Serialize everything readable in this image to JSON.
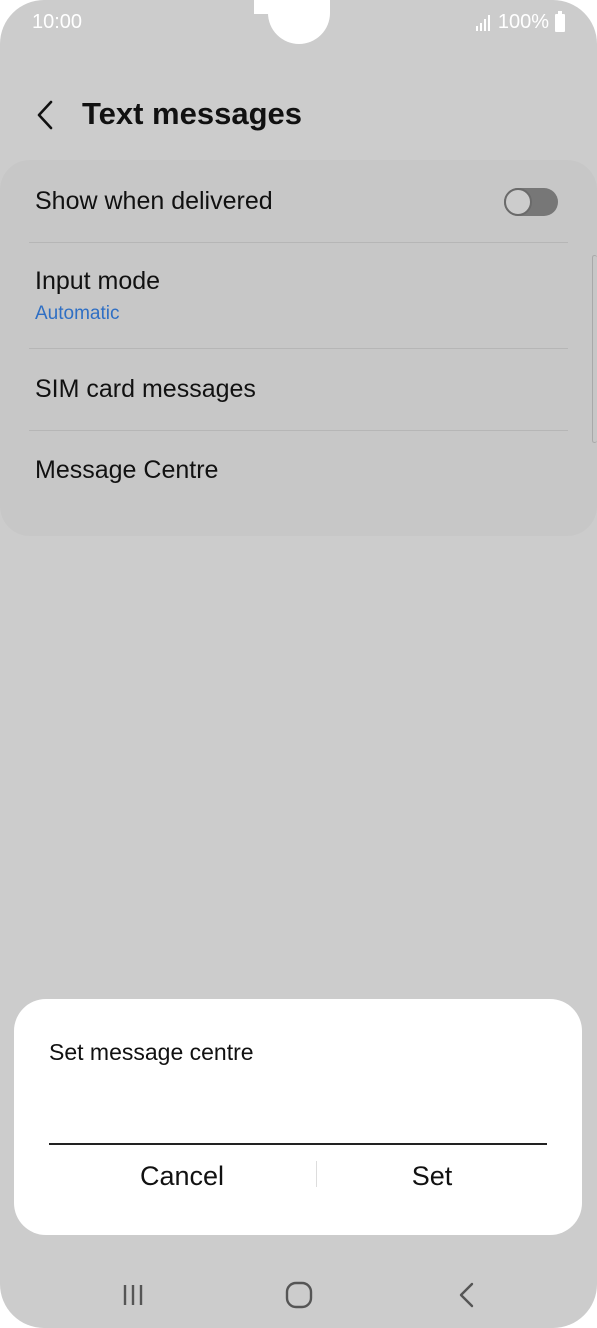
{
  "status_bar": {
    "time": "10:00",
    "battery": "100%",
    "icons": [
      "signal-icon",
      "battery-icon"
    ]
  },
  "header": {
    "title": "Text messages",
    "back_icon": "chevron-left-icon"
  },
  "settings": {
    "show_when_delivered": {
      "label": "Show when delivered",
      "enabled": false
    },
    "input_mode": {
      "label": "Input mode",
      "value": "Automatic"
    },
    "sim_card_messages": {
      "label": "SIM card messages"
    },
    "message_centre": {
      "label": "Message Centre"
    }
  },
  "dialog": {
    "title": "Set message centre",
    "input_value": "",
    "cancel_label": "Cancel",
    "set_label": "Set"
  },
  "nav_bar": {
    "icons": [
      "recents-icon",
      "home-icon",
      "back-icon"
    ]
  },
  "colors": {
    "background": "#cccccc",
    "accent": "#2f6fc4",
    "dialog": "#ffffff"
  }
}
